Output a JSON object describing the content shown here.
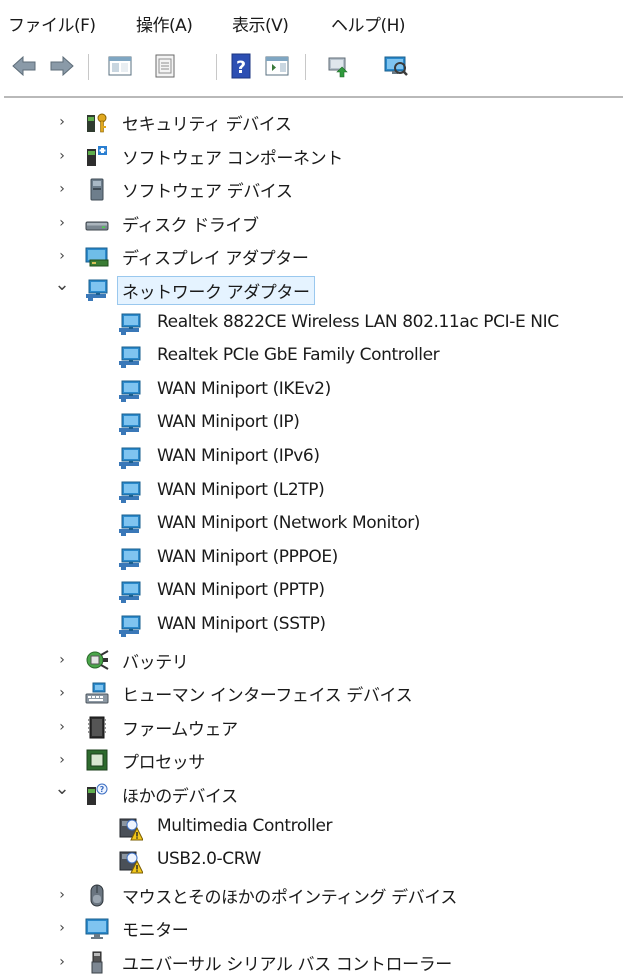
{
  "menu": [
    "ファイル(F)",
    "操作(A)",
    "表示(V)",
    "ヘルプ(H)"
  ],
  "toolbar": [
    "back-icon",
    "forward-icon",
    "show-hide-console-tree-icon",
    "properties-icon",
    "help-icon",
    "show-action-pane-icon",
    "update-driver-icon",
    "scan-hardware-icon"
  ],
  "tree": [
    {
      "label": "セキュリティ デバイス",
      "icon": "security-device-icon",
      "state": "collapsed",
      "level": 0
    },
    {
      "label": "ソフトウェア コンポーネント",
      "icon": "software-component-icon",
      "state": "collapsed",
      "level": 0
    },
    {
      "label": "ソフトウェア デバイス",
      "icon": "software-device-icon",
      "state": "collapsed",
      "level": 0
    },
    {
      "label": "ディスク ドライブ",
      "icon": "disk-drive-icon",
      "state": "collapsed",
      "level": 0
    },
    {
      "label": "ディスプレイ アダプター",
      "icon": "display-adapter-icon",
      "state": "collapsed",
      "level": 0
    },
    {
      "label": "ネットワーク アダプター",
      "icon": "network-adapter-icon",
      "state": "expanded",
      "level": 0,
      "selected": true
    },
    {
      "label": "Realtek 8822CE Wireless LAN 802.11ac PCI-E NIC",
      "icon": "network-adapter-icon",
      "level": 1
    },
    {
      "label": "Realtek PCIe GbE Family Controller",
      "icon": "network-adapter-icon",
      "level": 1
    },
    {
      "label": "WAN Miniport (IKEv2)",
      "icon": "network-adapter-icon",
      "level": 1
    },
    {
      "label": "WAN Miniport (IP)",
      "icon": "network-adapter-icon",
      "level": 1
    },
    {
      "label": "WAN Miniport (IPv6)",
      "icon": "network-adapter-icon",
      "level": 1
    },
    {
      "label": "WAN Miniport (L2TP)",
      "icon": "network-adapter-icon",
      "level": 1
    },
    {
      "label": "WAN Miniport (Network Monitor)",
      "icon": "network-adapter-icon",
      "level": 1
    },
    {
      "label": "WAN Miniport (PPPOE)",
      "icon": "network-adapter-icon",
      "level": 1
    },
    {
      "label": "WAN Miniport (PPTP)",
      "icon": "network-adapter-icon",
      "level": 1
    },
    {
      "label": "WAN Miniport (SSTP)",
      "icon": "network-adapter-icon",
      "level": 1
    },
    {
      "label": "バッテリ",
      "icon": "battery-icon",
      "state": "collapsed",
      "level": 0
    },
    {
      "label": "ヒューマン インターフェイス デバイス",
      "icon": "hid-icon",
      "state": "collapsed",
      "level": 0
    },
    {
      "label": "ファームウェア",
      "icon": "firmware-icon",
      "state": "collapsed",
      "level": 0
    },
    {
      "label": "プロセッサ",
      "icon": "processor-icon",
      "state": "collapsed",
      "level": 0
    },
    {
      "label": "ほかのデバイス",
      "icon": "other-devices-icon",
      "state": "expanded",
      "level": 0
    },
    {
      "label": "Multimedia Controller",
      "icon": "unknown-device-warning-icon",
      "level": 1
    },
    {
      "label": "USB2.0-CRW",
      "icon": "unknown-device-warning-icon",
      "level": 1
    },
    {
      "label": "マウスとそのほかのポインティング デバイス",
      "icon": "mouse-icon",
      "state": "collapsed",
      "level": 0
    },
    {
      "label": "モニター",
      "icon": "monitor-icon",
      "state": "collapsed",
      "level": 0
    },
    {
      "label": "ユニバーサル シリアル バス コントローラー",
      "icon": "usb-controller-icon",
      "state": "collapsed",
      "level": 0
    }
  ]
}
